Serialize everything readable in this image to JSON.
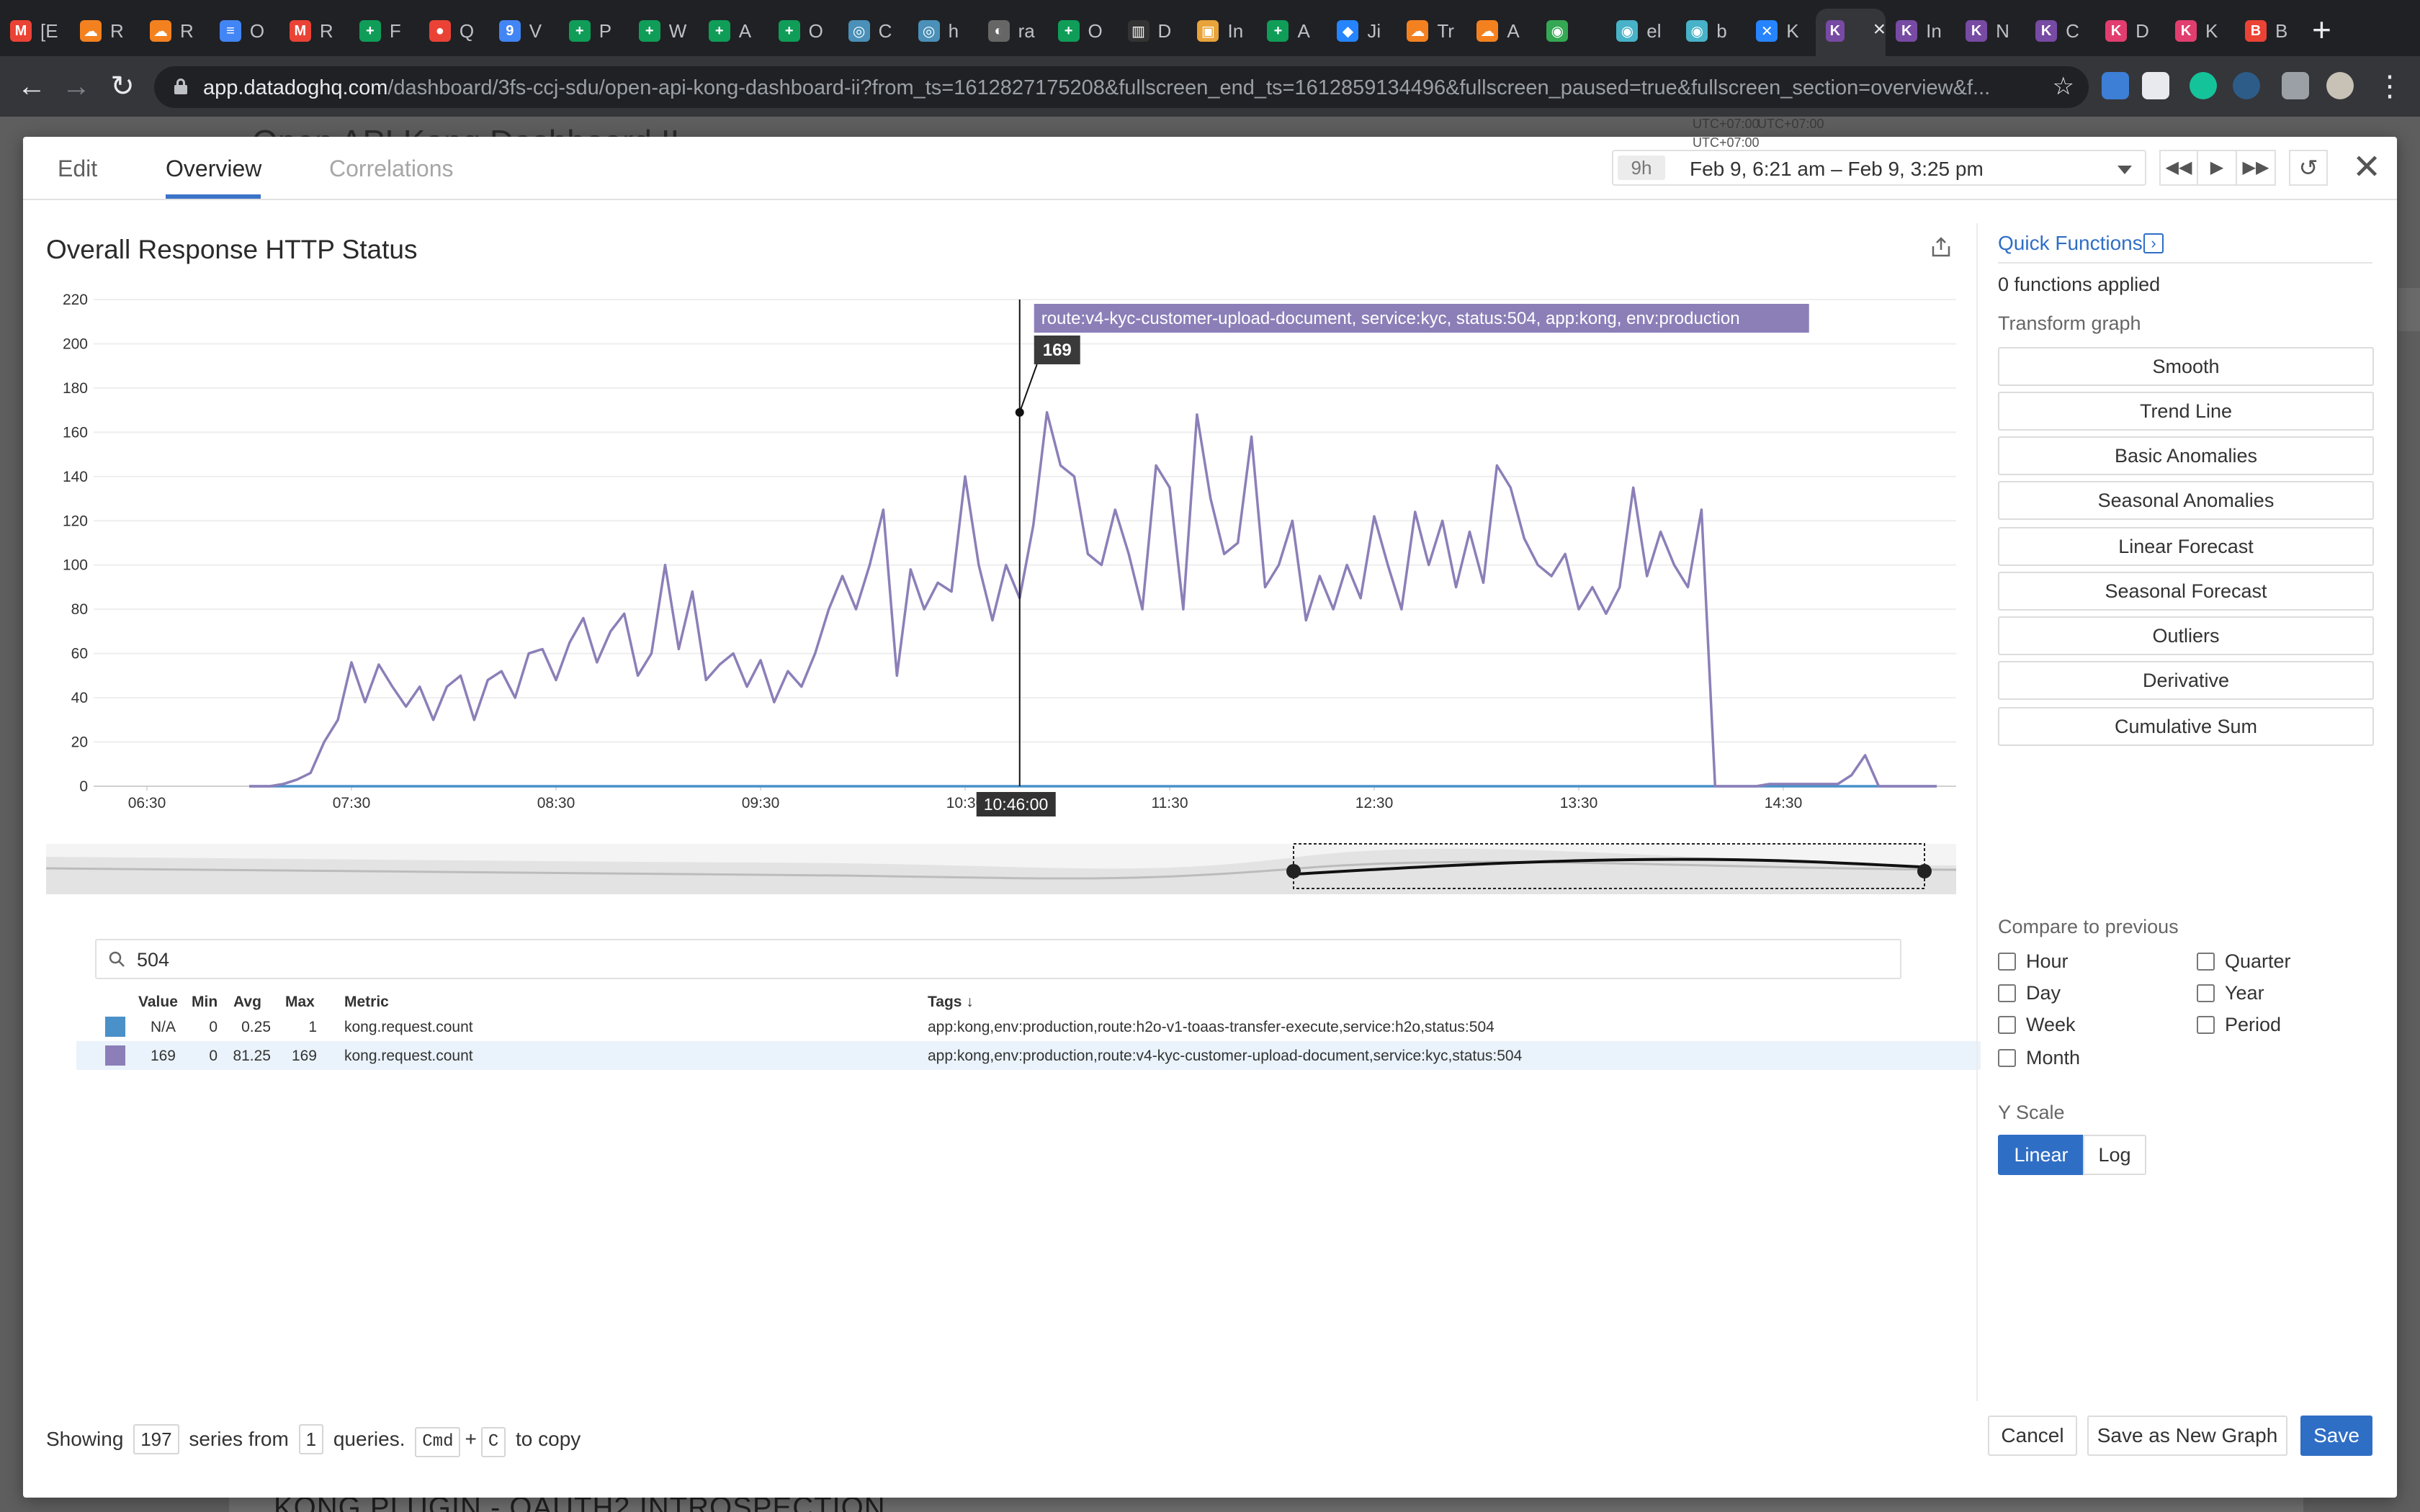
{
  "browser": {
    "tabs": [
      {
        "title": "[E",
        "color": "#ea4335",
        "glyph": "M",
        "active": false
      },
      {
        "title": "R",
        "color": "#f48120",
        "glyph": "☁",
        "active": false
      },
      {
        "title": "R",
        "color": "#f48120",
        "glyph": "☁",
        "active": false
      },
      {
        "title": "O",
        "color": "#4285f4",
        "glyph": "≡",
        "active": false
      },
      {
        "title": "R",
        "color": "#ea4335",
        "glyph": "M",
        "active": false
      },
      {
        "title": "F",
        "color": "#0f9d58",
        "glyph": "+",
        "active": false
      },
      {
        "title": "Q",
        "color": "#ea4335",
        "glyph": "●",
        "active": false
      },
      {
        "title": "V",
        "color": "#4285f4",
        "glyph": "9",
        "active": false
      },
      {
        "title": "P",
        "color": "#0f9d58",
        "glyph": "+",
        "active": false
      },
      {
        "title": "W",
        "color": "#0f9d58",
        "glyph": "+",
        "active": false
      },
      {
        "title": "A",
        "color": "#0f9d58",
        "glyph": "+",
        "active": false
      },
      {
        "title": "O",
        "color": "#0f9d58",
        "glyph": "+",
        "active": false
      },
      {
        "title": "C",
        "color": "#4a90b8",
        "glyph": "◎",
        "active": false
      },
      {
        "title": "h",
        "color": "#4a90b8",
        "glyph": "◎",
        "active": false
      },
      {
        "title": "ra",
        "color": "#666666",
        "glyph": "◐",
        "active": false
      },
      {
        "title": "O",
        "color": "#0f9d58",
        "glyph": "+",
        "active": false
      },
      {
        "title": "D",
        "color": "#333333",
        "glyph": "▥",
        "active": false
      },
      {
        "title": "In",
        "color": "#e8a33a",
        "glyph": "▣",
        "active": false
      },
      {
        "title": "A",
        "color": "#0f9d58",
        "glyph": "+",
        "active": false
      },
      {
        "title": "Ji",
        "color": "#2684ff",
        "glyph": "◆",
        "active": false
      },
      {
        "title": "Tr",
        "color": "#f48120",
        "glyph": "☁",
        "active": false
      },
      {
        "title": "A",
        "color": "#f48120",
        "glyph": "☁",
        "active": false
      },
      {
        "title": "",
        "color": "#34a853",
        "glyph": "◉",
        "active": false
      },
      {
        "title": "el",
        "color": "#47b2c8",
        "glyph": "◉",
        "active": false
      },
      {
        "title": "b",
        "color": "#47b2c8",
        "glyph": "◉",
        "active": false
      },
      {
        "title": "K",
        "color": "#2684ff",
        "glyph": "✕",
        "active": false
      },
      {
        "title": "",
        "color": "#774aa4",
        "glyph": "K",
        "active": true
      },
      {
        "title": "In",
        "color": "#774aa4",
        "glyph": "K",
        "active": false
      },
      {
        "title": "N",
        "color": "#774aa4",
        "glyph": "K",
        "active": false
      },
      {
        "title": "C",
        "color": "#774aa4",
        "glyph": "K",
        "active": false
      },
      {
        "title": "D",
        "color": "#e13e6f",
        "glyph": "K",
        "active": false
      },
      {
        "title": "K",
        "color": "#e13e6f",
        "glyph": "K",
        "active": false
      },
      {
        "title": "B",
        "color": "#ea4335",
        "glyph": "B",
        "active": false
      }
    ],
    "url_host": "app.datadoghq.com",
    "url_path": "/dashboard/3fs-ccj-sdu/open-api-kong-dashboard-ii?from_ts=1612827175208&fullscreen_end_ts=1612859134496&fullscreen_paused=true&fullscreen_section=overview&f..."
  },
  "background": {
    "dashboard_title": "Open API Kong Dashboard II",
    "utc_1": "UTC+07:00",
    "utc_2": "UTC+07:00",
    "footer_text": "KONG PLUGIN - OAUTH2 INTROSPECTION"
  },
  "modal": {
    "tabs": [
      {
        "label": "Edit"
      },
      {
        "label": "Overview"
      },
      {
        "label": "Correlations"
      }
    ],
    "time": {
      "utc": "UTC+07:00",
      "span": "9h",
      "range": "Feb 9, 6:21 am – Feb 9, 3:25 pm"
    },
    "graph_title": "Overall Response HTTP Status",
    "tooltip": {
      "series": "route:v4-kyc-customer-upload-document, service:kyc, status:504, app:kong, env:production",
      "value": "169",
      "time": "10:46:00"
    },
    "search": {
      "value": "504"
    },
    "legend": {
      "headers": {
        "value": "Value",
        "min": "Min",
        "avg": "Avg",
        "max": "Max",
        "metric": "Metric",
        "tags": "Tags ↓"
      },
      "rows": [
        {
          "color": "#4a90c9",
          "value": "N/A",
          "min": "0",
          "avg": "0.25",
          "max": "1",
          "metric": "kong.request.count",
          "tags": "app:kong,env:production,route:h2o-v1-toaas-transfer-execute,service:h2o,status:504"
        },
        {
          "color": "#8c7fb8",
          "value": "169",
          "min": "0",
          "avg": "81.25",
          "max": "169",
          "metric": "kong.request.count",
          "tags": "app:kong,env:production,route:v4-kyc-customer-upload-document,service:kyc,status:504"
        }
      ]
    },
    "quick_functions": {
      "title": "Quick Functions",
      "applied": "0 functions applied",
      "transform_label": "Transform graph",
      "buttons": [
        "Smooth",
        "Trend Line",
        "Basic Anomalies",
        "Seasonal Anomalies",
        "Linear Forecast",
        "Seasonal Forecast",
        "Outliers",
        "Derivative",
        "Cumulative Sum"
      ],
      "compare_label": "Compare to previous",
      "compare": [
        "Hour",
        "Day",
        "Week",
        "Month",
        "Quarter",
        "Year",
        "Period"
      ],
      "yscale_label": "Y Scale",
      "yscale": [
        "Linear",
        "Log"
      ]
    },
    "footer": {
      "showing": "Showing",
      "series_count": "197",
      "series_from": "series from",
      "query_count": "1",
      "queries": "queries.",
      "key1": "Cmd",
      "plus": "+",
      "key2": "C",
      "to_copy": "to copy",
      "cancel": "Cancel",
      "save_new": "Save as New Graph",
      "save": "Save"
    }
  },
  "chart_data": {
    "type": "line",
    "title": "Overall Response HTTP Status",
    "ylim": [
      0,
      220
    ],
    "yticks": [
      0,
      20,
      40,
      60,
      80,
      100,
      120,
      140,
      160,
      180,
      200,
      220
    ],
    "xticks": [
      "06:30",
      "07:30",
      "08:30",
      "09:30",
      "10:30",
      "11:30",
      "12:30",
      "13:30",
      "14:30"
    ],
    "xlim_minutes": [
      375,
      915
    ],
    "grid": true,
    "legend": "none",
    "series": [
      {
        "color": "#8c7fb8",
        "x_minutes": [
          420,
          426,
          430,
          434,
          438,
          442,
          446,
          450,
          454,
          458,
          462,
          466,
          470,
          474,
          478,
          482,
          486,
          490,
          494,
          498,
          502,
          506,
          510,
          514,
          518,
          522,
          526,
          530,
          534,
          538,
          542,
          546,
          550,
          554,
          558,
          562,
          566,
          570,
          574,
          578,
          582,
          586,
          590,
          594,
          598,
          602,
          606,
          610,
          614,
          618,
          622,
          626,
          630,
          634,
          638,
          642,
          646,
          650,
          654,
          658,
          662,
          666,
          670,
          674,
          678,
          682,
          686,
          690,
          694,
          698,
          702,
          706,
          710,
          714,
          718,
          722,
          726,
          730,
          734,
          738,
          742,
          746,
          750,
          754,
          758,
          762,
          766,
          770,
          774,
          778,
          782,
          786,
          790,
          794,
          798,
          802,
          806,
          810,
          814,
          818,
          822,
          826,
          830,
          834,
          838,
          842,
          846,
          850,
          854,
          858,
          862,
          866,
          870,
          874,
          878,
          882,
          886,
          890,
          894,
          898,
          902,
          906,
          910,
          915
        ],
        "values": [
          0,
          0,
          1,
          3,
          6,
          20,
          30,
          56,
          38,
          55,
          45,
          36,
          45,
          30,
          45,
          50,
          30,
          48,
          52,
          40,
          60,
          62,
          48,
          65,
          76,
          56,
          70,
          78,
          50,
          60,
          100,
          62,
          88,
          48,
          55,
          60,
          45,
          57,
          38,
          52,
          45,
          60,
          80,
          95,
          80,
          100,
          125,
          50,
          98,
          80,
          92,
          88,
          140,
          100,
          75,
          100,
          85,
          118,
          169,
          145,
          140,
          105,
          100,
          125,
          105,
          80,
          145,
          135,
          80,
          168,
          130,
          105,
          110,
          158,
          90,
          100,
          120,
          75,
          95,
          80,
          100,
          85,
          122,
          100,
          80,
          124,
          100,
          120,
          90,
          115,
          92,
          145,
          135,
          112,
          100,
          95,
          105,
          80,
          90,
          78,
          90,
          135,
          95,
          115,
          100,
          90,
          125,
          0,
          0,
          0,
          0,
          1,
          1,
          1,
          1,
          1,
          1,
          5,
          14,
          0,
          0,
          0,
          0,
          0
        ]
      },
      {
        "color": "#4a90c9",
        "x_minutes": [
          420,
          915
        ],
        "values": [
          0,
          0
        ]
      }
    ]
  }
}
